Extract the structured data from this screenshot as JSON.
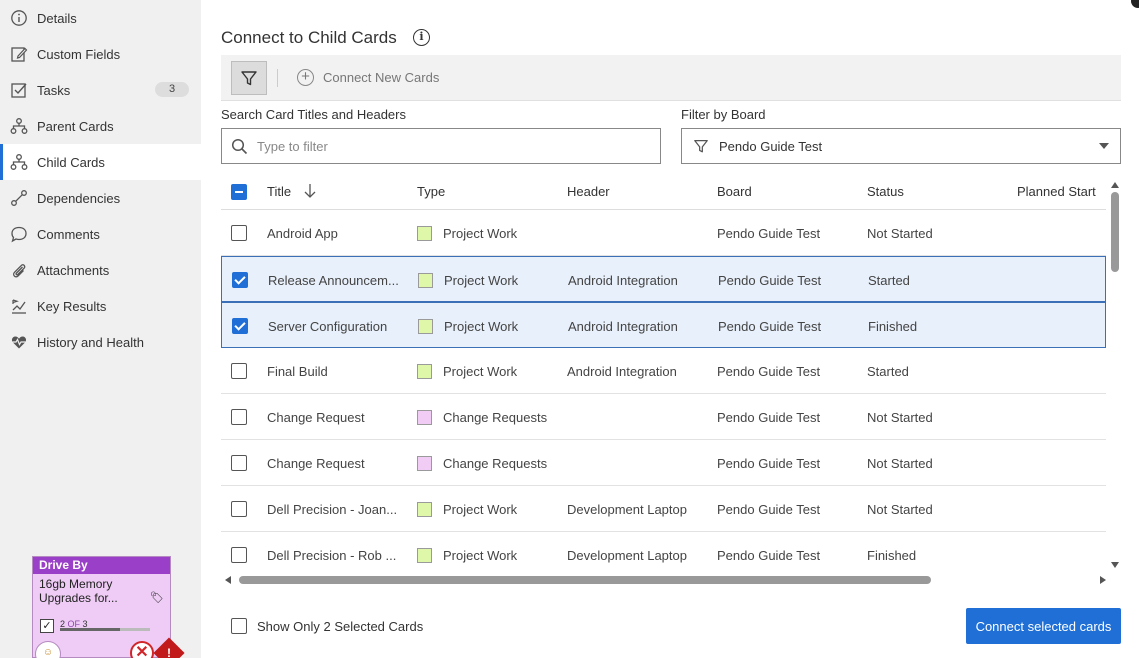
{
  "sidebar": {
    "items": [
      {
        "label": "Details",
        "icon": "info-icon"
      },
      {
        "label": "Custom Fields",
        "icon": "edit-icon"
      },
      {
        "label": "Tasks",
        "icon": "checkbox-icon",
        "badge": "3"
      },
      {
        "label": "Parent Cards",
        "icon": "hierarchy-icon"
      },
      {
        "label": "Child Cards",
        "icon": "hierarchy-icon",
        "active": true
      },
      {
        "label": "Dependencies",
        "icon": "link-icon"
      },
      {
        "label": "Comments",
        "icon": "comment-icon"
      },
      {
        "label": "Attachments",
        "icon": "paperclip-icon"
      },
      {
        "label": "Key Results",
        "icon": "key-results-icon"
      },
      {
        "label": "History and Health",
        "icon": "heart-icon"
      }
    ]
  },
  "card_preview": {
    "type_label": "Drive By",
    "title": "16gb Memory Upgrades for...",
    "progress_current": "2",
    "progress_of": "OF",
    "progress_total": "3",
    "progress_fraction": 0.667,
    "colors": {
      "header": "#9a3fc7",
      "body": "#eeccf5"
    }
  },
  "main": {
    "title": "Connect to Child Cards",
    "toolbar": {
      "connect_new_label": "Connect New Cards"
    },
    "search": {
      "label": "Search Card Titles and Headers",
      "placeholder": "Type to filter",
      "value": ""
    },
    "board_filter": {
      "label": "Filter by Board",
      "selected": "Pendo Guide Test"
    },
    "table": {
      "columns": [
        "Title",
        "Type",
        "Header",
        "Board",
        "Status",
        "Planned Start"
      ],
      "rows": [
        {
          "checked": false,
          "title": "Android App",
          "type": "Project Work",
          "type_color": "#dff7a8",
          "header": "",
          "board": "Pendo Guide Test",
          "status": "Not Started"
        },
        {
          "checked": true,
          "title": "Release Announcem...",
          "type": "Project Work",
          "type_color": "#dff7a8",
          "header": "Android Integration",
          "board": "Pendo Guide Test",
          "status": "Started"
        },
        {
          "checked": true,
          "title": "Server Configuration",
          "type": "Project Work",
          "type_color": "#dff7a8",
          "header": "Android Integration",
          "board": "Pendo Guide Test",
          "status": "Finished"
        },
        {
          "checked": false,
          "title": "Final Build",
          "type": "Project Work",
          "type_color": "#dff7a8",
          "header": "Android Integration",
          "board": "Pendo Guide Test",
          "status": "Started"
        },
        {
          "checked": false,
          "title": "Change Request",
          "type": "Change Requests",
          "type_color": "#f1ccf5",
          "header": "",
          "board": "Pendo Guide Test",
          "status": "Not Started"
        },
        {
          "checked": false,
          "title": "Change Request",
          "type": "Change Requests",
          "type_color": "#f1ccf5",
          "header": "",
          "board": "Pendo Guide Test",
          "status": "Not Started"
        },
        {
          "checked": false,
          "title": "Dell Precision - Joan...",
          "type": "Project Work",
          "type_color": "#dff7a8",
          "header": "Development Laptop",
          "board": "Pendo Guide Test",
          "status": "Not Started"
        },
        {
          "checked": false,
          "title": "Dell Precision - Rob ...",
          "type": "Project Work",
          "type_color": "#dff7a8",
          "header": "Development Laptop",
          "board": "Pendo Guide Test",
          "status": "Finished"
        }
      ]
    },
    "footer": {
      "show_only_label": "Show Only 2 Selected Cards",
      "connect_button": "Connect selected cards"
    },
    "colors": {
      "accent": "#1f6fd6",
      "selected_row": "#e8f0fb"
    }
  }
}
